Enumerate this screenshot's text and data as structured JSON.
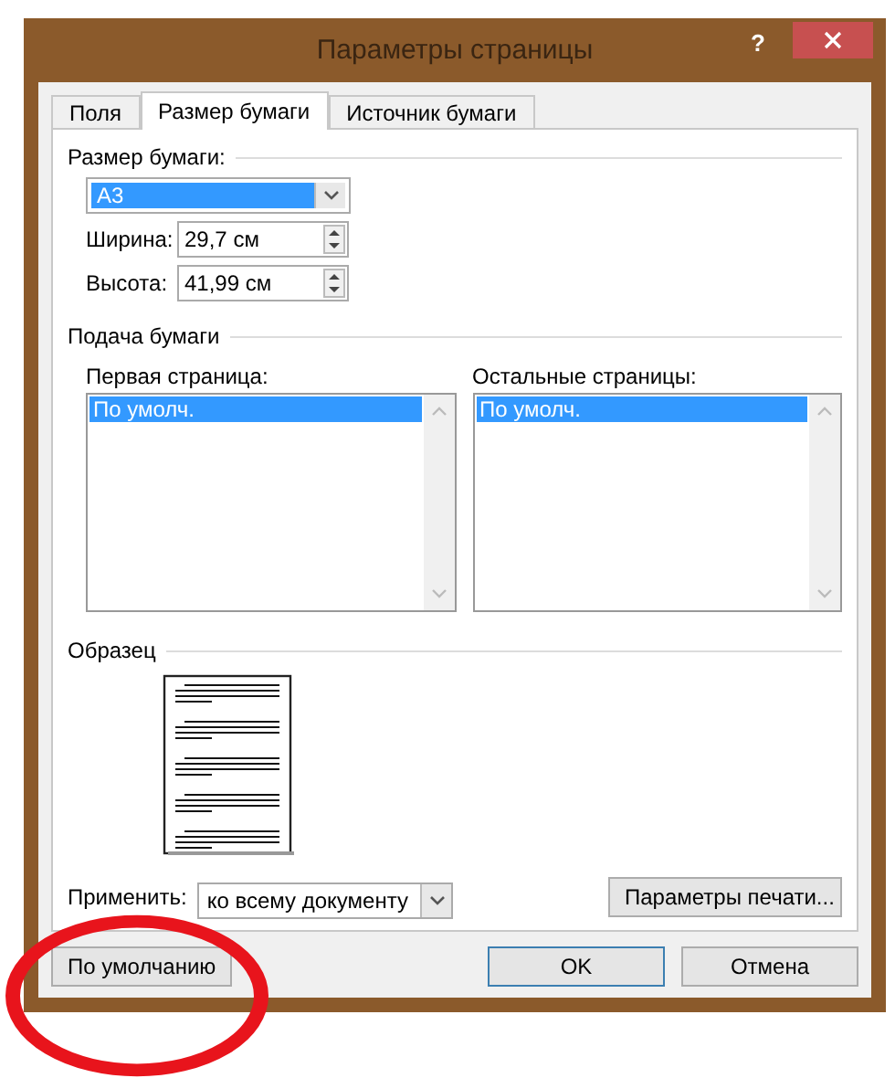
{
  "window": {
    "title": "Параметры страницы",
    "help": "?"
  },
  "tabs": [
    {
      "label": "Поля",
      "selected": false
    },
    {
      "label": "Размер бумаги",
      "selected": true
    },
    {
      "label": "Источник бумаги",
      "selected": false
    }
  ],
  "paper_size": {
    "heading": "Размер бумаги:",
    "value": "A3",
    "width_label": "Ширина:",
    "width": "29,7 см",
    "height_label": "Высота:",
    "height": "41,99 см"
  },
  "paper_feed": {
    "heading": "Подача бумаги",
    "lists": [
      {
        "label": "Первая страница:",
        "items": [
          {
            "text": "По умолч.",
            "selected": true
          }
        ]
      },
      {
        "label": "Остальные страницы:",
        "items": [
          {
            "text": "По умолч.",
            "selected": true
          }
        ]
      }
    ]
  },
  "preview": {
    "heading": "Образец"
  },
  "apply": {
    "label": "Применить:",
    "value": "ко всему документу"
  },
  "print_options_button": "Параметры печати...",
  "buttons": [
    {
      "label": "По умолчанию",
      "kind": "default"
    },
    {
      "label": "OK",
      "kind": "primary"
    },
    {
      "label": "Отмена",
      "kind": "normal"
    }
  ]
}
